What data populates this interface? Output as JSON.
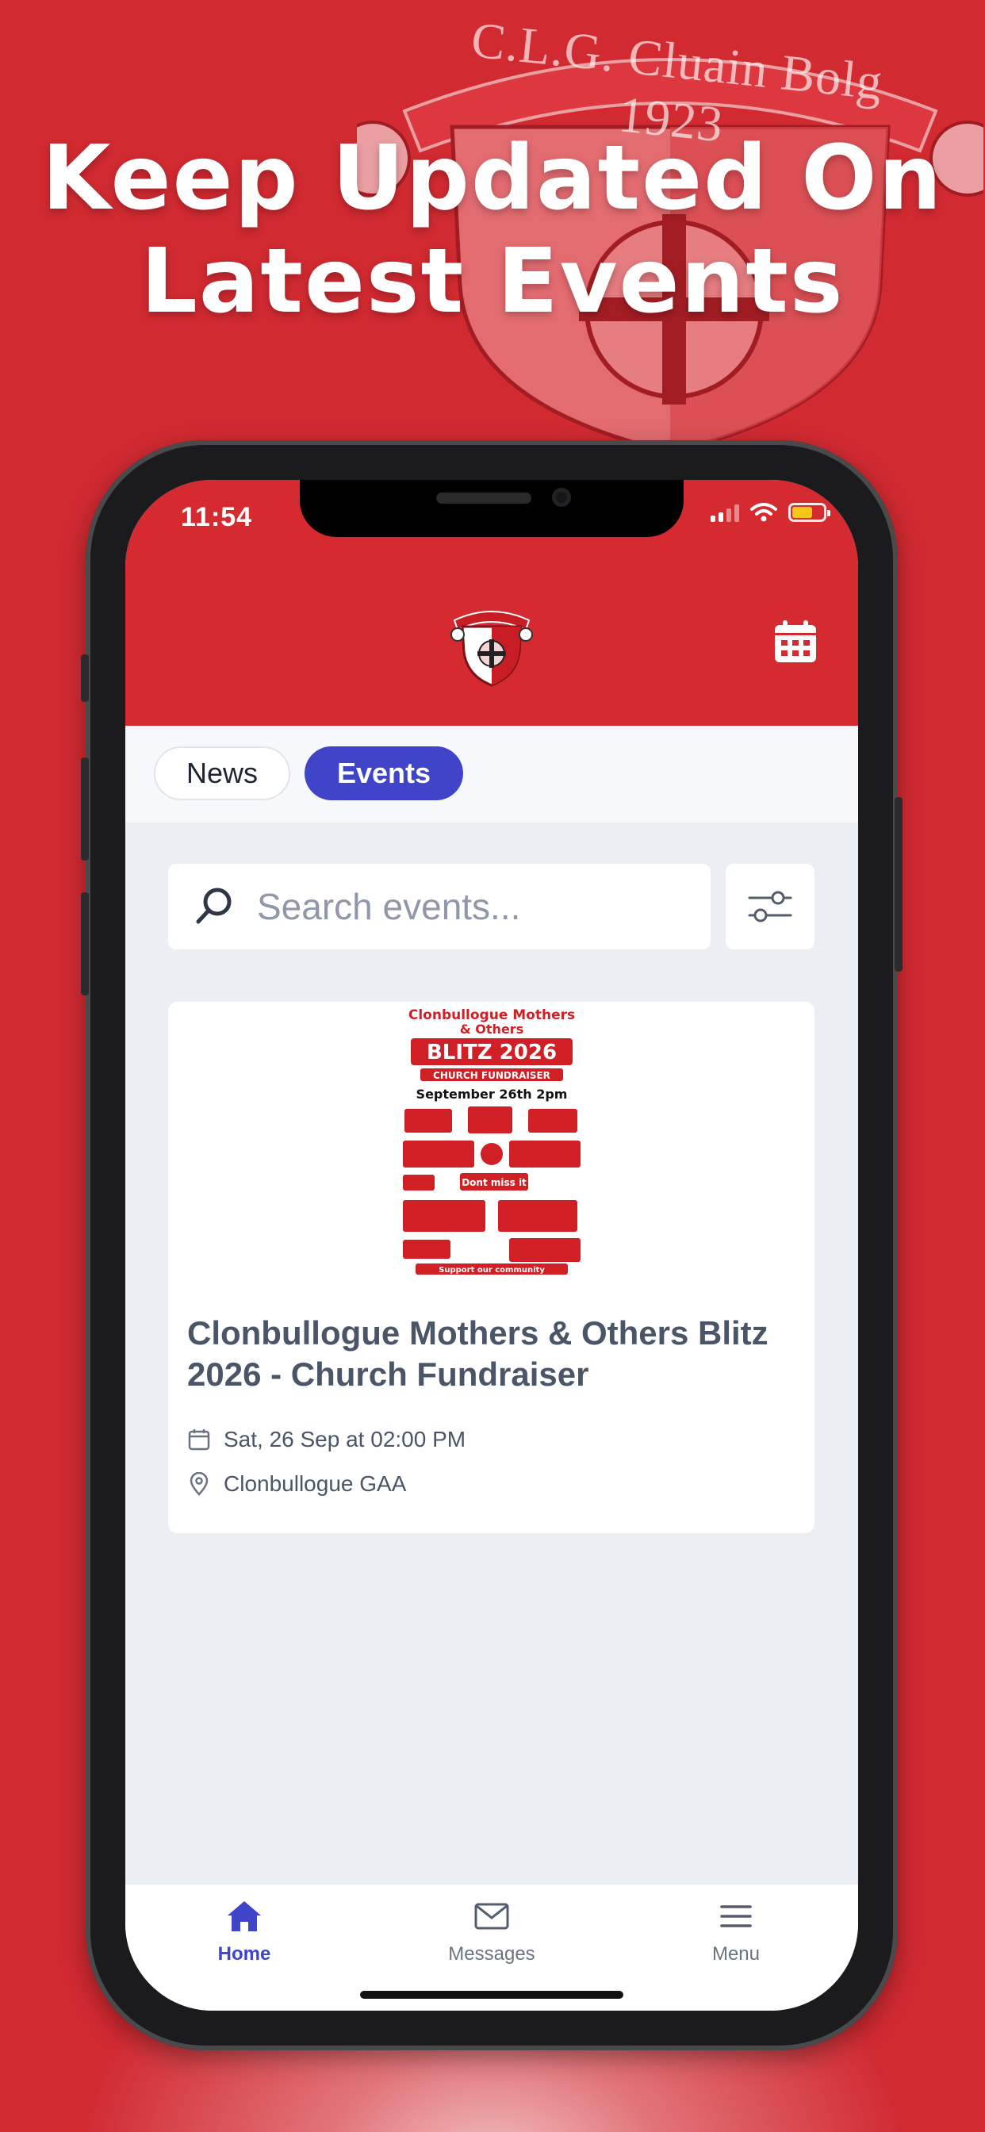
{
  "promo": {
    "headline_line1": "Keep Updated On",
    "headline_line2": "Latest Events",
    "crest_text": "C.L.G. Cluain Bolg 1923"
  },
  "status_bar": {
    "time": "11:54"
  },
  "header": {
    "calendar_icon": "calendar-icon",
    "logo": "club-crest-logo"
  },
  "tabs": [
    {
      "label": "News",
      "selected": false
    },
    {
      "label": "Events",
      "selected": true
    }
  ],
  "search": {
    "placeholder": "Search events...",
    "value": ""
  },
  "events": [
    {
      "title": "Clonbullogue Mothers & Others Blitz 2026 - Church Fundraiser",
      "date": "Sat, 26 Sep at 02:00 PM",
      "location": "Clonbullogue GAA",
      "poster": {
        "line1": "Clonbullogue Mothers",
        "line2": "& Others",
        "line3": "BLITZ 2026",
        "line4": "CHURCH FUNDRAISER",
        "line5": "September 26th 2pm",
        "line6": "Dont miss it",
        "line7": "Support our community"
      }
    }
  ],
  "bottom_nav": [
    {
      "label": "Home",
      "icon": "home-icon",
      "active": true
    },
    {
      "label": "Messages",
      "icon": "mail-icon",
      "active": false
    },
    {
      "label": "Menu",
      "icon": "hamburger-icon",
      "active": false
    }
  ],
  "colors": {
    "brand_red": "#d42a30",
    "accent": "#3f44c9",
    "text_muted": "#4a5567"
  }
}
